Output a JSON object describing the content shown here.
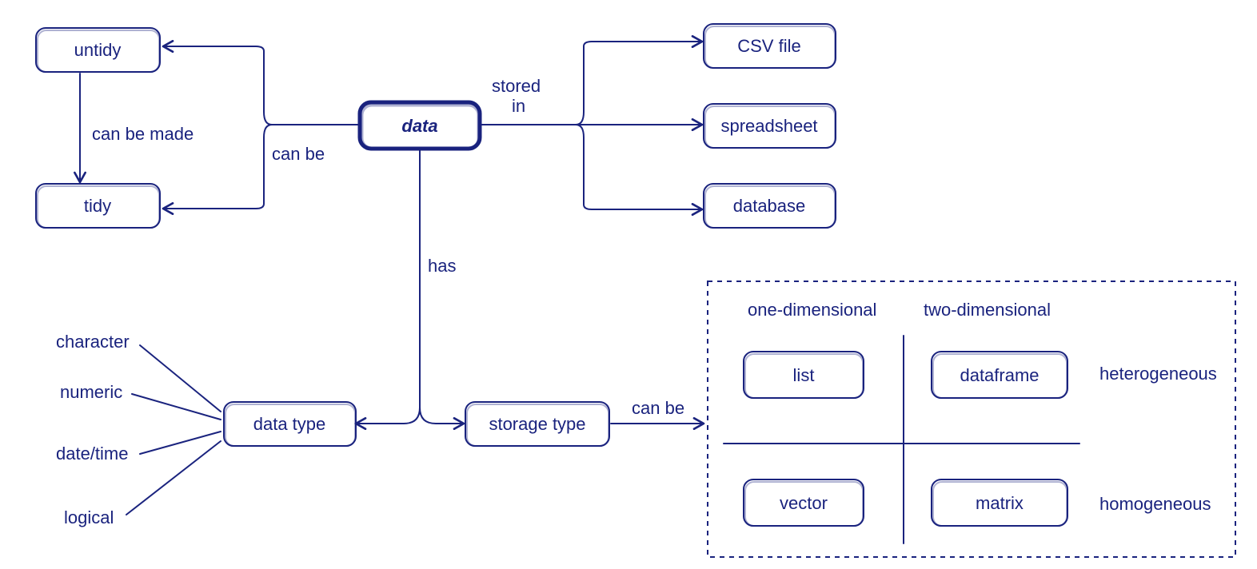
{
  "nodes": {
    "data": "data",
    "untidy": "untidy",
    "tidy": "tidy",
    "csv": "CSV file",
    "spreadsheet": "spreadsheet",
    "database": "database",
    "data_type": "data type",
    "storage_type": "storage type",
    "list": "list",
    "dataframe": "dataframe",
    "vector": "vector",
    "matrix": "matrix"
  },
  "edges": {
    "can_be_made": "can be made",
    "can_be_tidy": "can be",
    "stored_in": "stored in",
    "has": "has",
    "can_be_storage": "can be"
  },
  "leaves": {
    "character": "character",
    "numeric": "numeric",
    "datetime": "date/time",
    "logical": "logical"
  },
  "quadrant": {
    "col1": "one-dimensional",
    "col2": "two-dimensional",
    "row1": "heterogeneous",
    "row2": "homogeneous"
  }
}
